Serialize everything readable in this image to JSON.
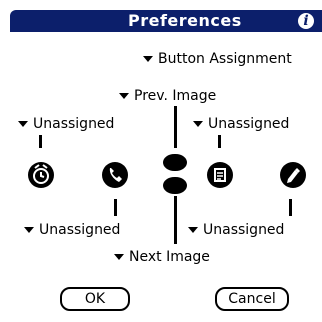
{
  "title": "Preferences",
  "info_glyph": "i",
  "button_assignment": "Button Assignment",
  "scroll_up": "Prev. Image",
  "scroll_down": "Next Image",
  "app1": "Unassigned",
  "app2": "Unassigned",
  "app3": "Unassigned",
  "app4": "Unassigned",
  "ok_label": "OK",
  "cancel_label": "Cancel",
  "icons": [
    "datebook-icon",
    "phone-icon",
    "scroll-up-button-icon",
    "scroll-down-button-icon",
    "todo-icon",
    "memo-icon"
  ],
  "colors": {
    "title_bar": "#0c1f6b",
    "title_text": "#ffffff"
  }
}
